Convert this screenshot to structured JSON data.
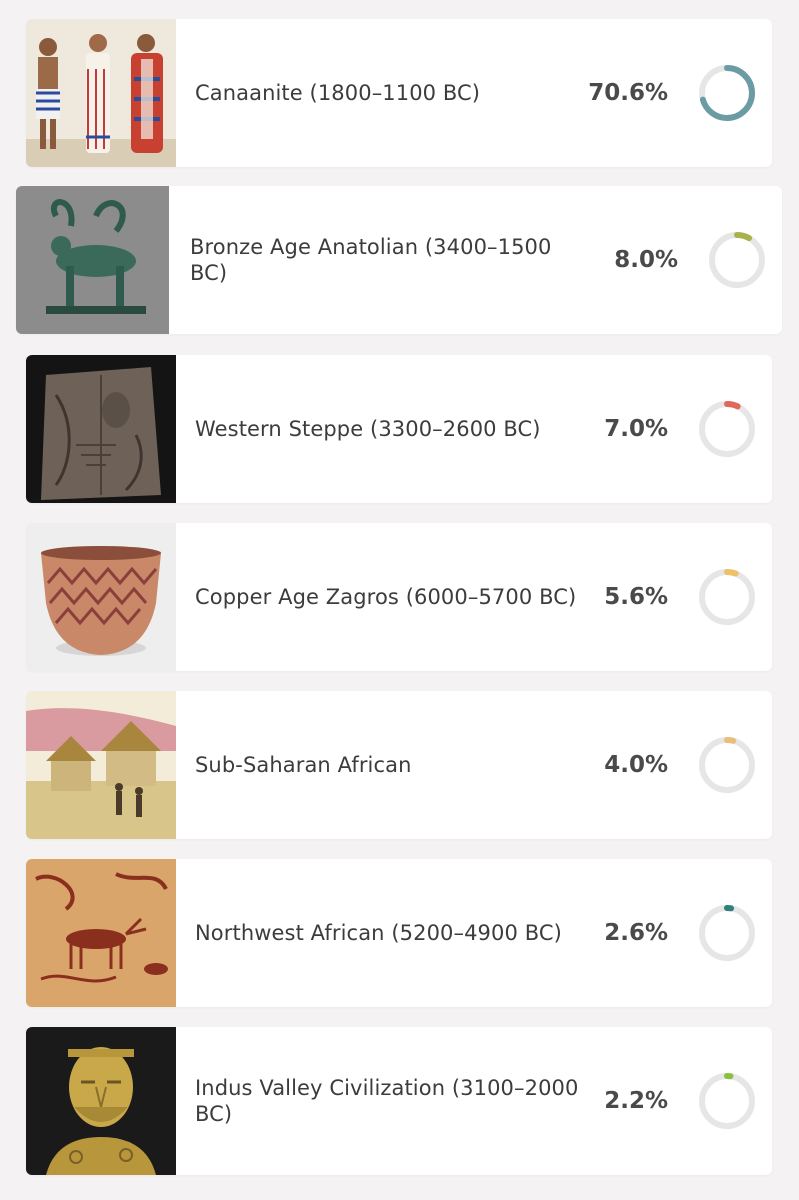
{
  "items": [
    {
      "label": "Canaanite (1800–1100 BC)",
      "percent": "70.6%",
      "value": 70.6,
      "color": "#6b9ba3",
      "image": "canaanite-figures-image"
    },
    {
      "label": "Bronze Age Anatolian (3400–1500 BC)",
      "percent": "8.0%",
      "value": 8.0,
      "color": "#a9b14a",
      "image": "bronze-stag-statue-image"
    },
    {
      "label": "Western Steppe (3300–2600 BC)",
      "percent": "7.0%",
      "value": 7.0,
      "color": "#e0685a",
      "image": "stone-stele-image"
    },
    {
      "label": "Copper Age Zagros (6000–5700 BC)",
      "percent": "5.6%",
      "value": 5.6,
      "color": "#f0c066",
      "image": "painted-pottery-image"
    },
    {
      "label": "Sub-Saharan African",
      "percent": "4.0%",
      "value": 4.0,
      "color": "#e8bf7a",
      "image": "african-village-image"
    },
    {
      "label": "Northwest African (5200–4900 BC)",
      "percent": "2.6%",
      "value": 2.6,
      "color": "#2f7f7a",
      "image": "rock-art-image"
    },
    {
      "label": "Indus Valley Civilization (3100–2000 BC)",
      "percent": "2.2%",
      "value": 2.2,
      "color": "#8bbf3f",
      "image": "priest-king-bust-image"
    }
  ]
}
